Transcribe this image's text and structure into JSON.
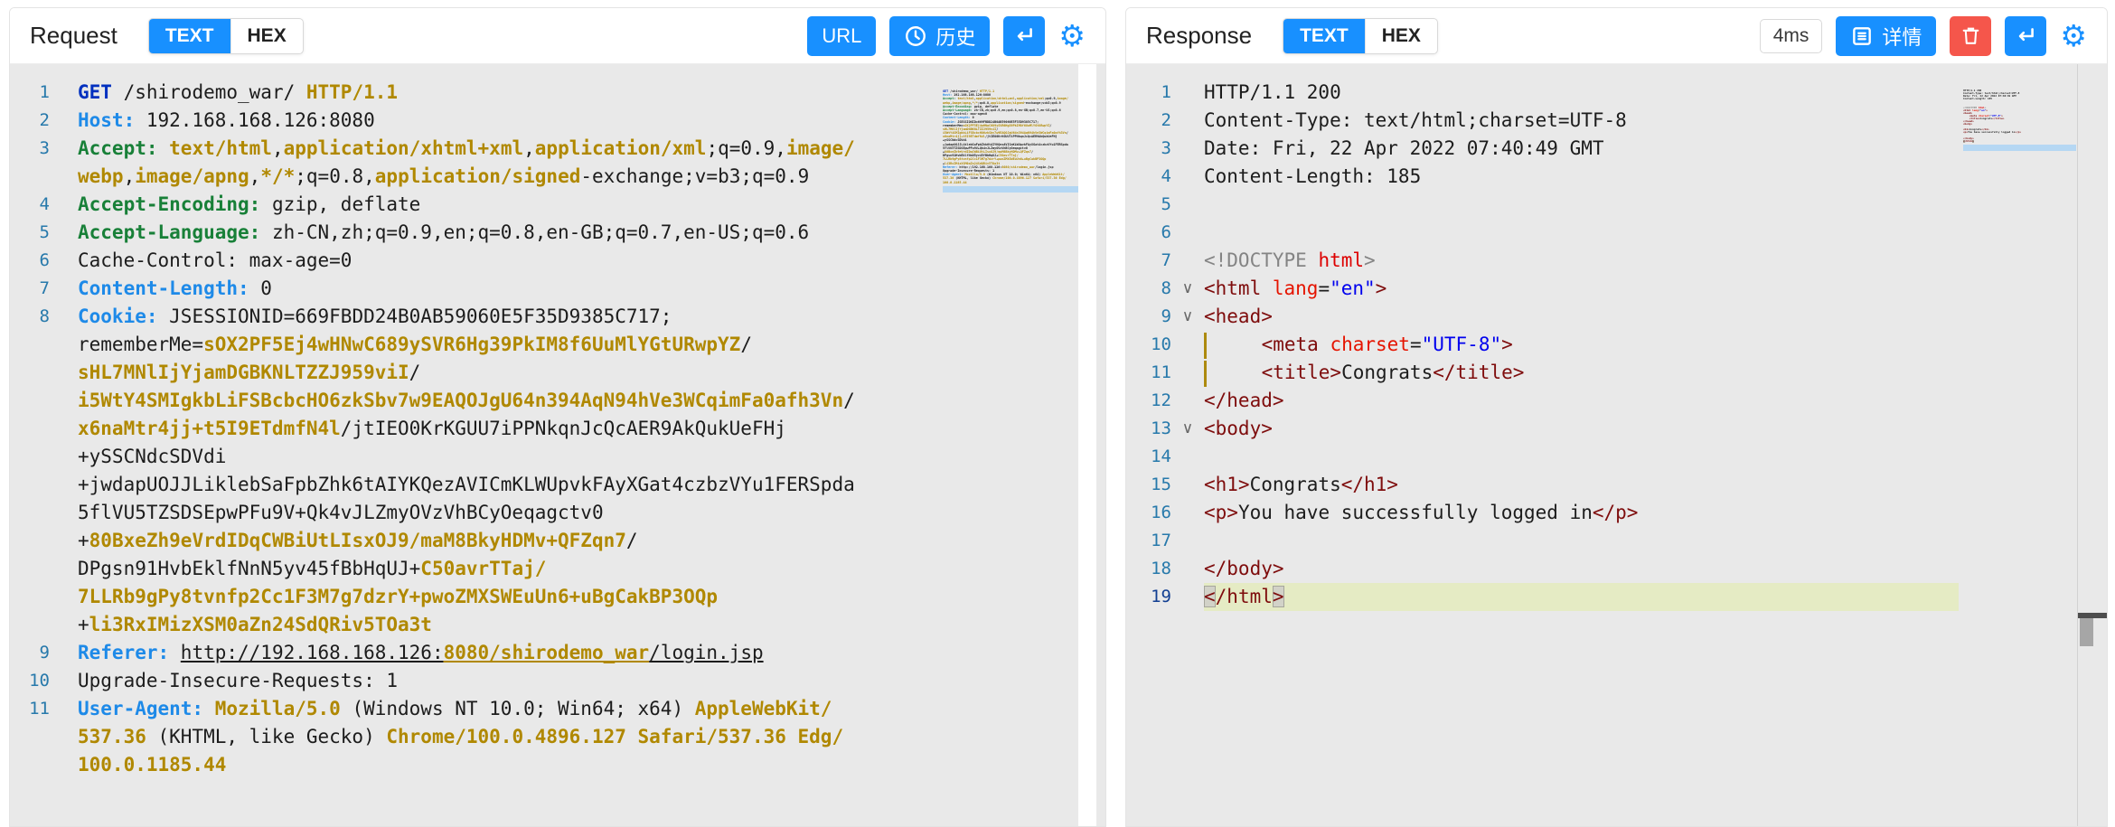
{
  "colors": {
    "accent": "#1890ff",
    "danger": "#f5564b",
    "editor_bg": "#e9e9e9",
    "line_highlight": "#e5ebc4",
    "gold": "#b08800"
  },
  "request": {
    "title": "Request",
    "tabs": [
      {
        "label": "TEXT",
        "active": true
      },
      {
        "label": "HEX",
        "active": false
      }
    ],
    "buttons": {
      "url": "URL",
      "history": "历史"
    },
    "icons": [
      "clock-icon",
      "enter-icon",
      "gear-icon"
    ],
    "lines": [
      {
        "n": "1",
        "s": [
          [
            "k",
            "GET"
          ],
          [
            "p",
            " /shirodemo_war/ "
          ],
          [
            "g",
            "HTTP/1.1"
          ]
        ]
      },
      {
        "n": "2",
        "s": [
          [
            "b",
            "Host: "
          ],
          [
            "p",
            "192.168.168.126:8080"
          ]
        ]
      },
      {
        "n": "3",
        "s": [
          [
            "gr",
            "Accept: "
          ],
          [
            "g",
            "text/html"
          ],
          [
            "p",
            ","
          ],
          [
            "g",
            "application/xhtml+xml"
          ],
          [
            "p",
            ","
          ],
          [
            "g",
            "application/xml"
          ],
          [
            "p",
            ";q=0.9,"
          ],
          [
            "g",
            "image/"
          ]
        ]
      },
      {
        "n": "",
        "s": [
          [
            "g",
            "webp"
          ],
          [
            "p",
            ","
          ],
          [
            "g",
            "image/apng"
          ],
          [
            "p",
            ","
          ],
          [
            "g",
            "*/*"
          ],
          [
            "p",
            ";q=0.8,"
          ],
          [
            "g",
            "application/signed"
          ],
          [
            "p",
            "-exchange;v=b3;q=0.9"
          ]
        ]
      },
      {
        "n": "4",
        "s": [
          [
            "gr",
            "Accept-Encoding: "
          ],
          [
            "p",
            "gzip, deflate"
          ]
        ]
      },
      {
        "n": "5",
        "s": [
          [
            "gr",
            "Accept-Language: "
          ],
          [
            "p",
            "zh-CN,zh;q=0.9,en;q=0.8,en-GB;q=0.7,en-US;q=0.6"
          ]
        ]
      },
      {
        "n": "6",
        "s": [
          [
            "p",
            "Cache-Control: max-age=0"
          ]
        ]
      },
      {
        "n": "7",
        "s": [
          [
            "b",
            "Content-Length: "
          ],
          [
            "p",
            "0"
          ]
        ]
      },
      {
        "n": "8",
        "s": [
          [
            "b",
            "Cookie: "
          ],
          [
            "p",
            "JSESSIONID=669FBDD24B0AB59060E5F35D9385C717;"
          ]
        ]
      },
      {
        "n": "",
        "s": [
          [
            "p",
            "rememberMe="
          ],
          [
            "g",
            "sOX2PF5Ej4wHNwC689ySVR6Hg39PkIM8f6UuMlYGtURwpYZ"
          ],
          [
            "p",
            "/"
          ]
        ]
      },
      {
        "n": "",
        "s": [
          [
            "g",
            "sHL7MNlIjYjamDGBKNLTZZJ959viI"
          ],
          [
            "p",
            "/"
          ]
        ]
      },
      {
        "n": "",
        "s": [
          [
            "g",
            "i5WtY4SMIgkbLiFSBcbcHO6zkSbv7w9EAQOJgU64n394AqN94hVe3WCqimFa0afh3Vn"
          ],
          [
            "p",
            "/"
          ]
        ]
      },
      {
        "n": "",
        "s": [
          [
            "g",
            "x6naMtr4jj+t5I9ETdmfN4l"
          ],
          [
            "p",
            "/jtIEO0KrKGUU7iPPNkqnJcQcAER9AkQukUeFHj"
          ]
        ]
      },
      {
        "n": "",
        "s": [
          [
            "p",
            "+ySSCNdcSDVdi"
          ]
        ]
      },
      {
        "n": "",
        "s": [
          [
            "p",
            "+jwdapUOJJLiklebSaFpbZhk6tAIYKQezAVICmKLWUpvkFAyXGat4czbzVYu1FERSpda"
          ]
        ]
      },
      {
        "n": "",
        "s": [
          [
            "p",
            "5flVU5TZSDSEpwPFu9V+Qk4vJLZmyOVzVhBCyOeqagctv0"
          ]
        ]
      },
      {
        "n": "",
        "s": [
          [
            "p",
            "+"
          ],
          [
            "g",
            "80BxeZh9eVrdIDqCWBiUtLIsxOJ9/maM8BkyHDMv+QFZqn7"
          ],
          [
            "p",
            "/"
          ]
        ]
      },
      {
        "n": "",
        "s": [
          [
            "p",
            "DPgsn91HvbEklfNnN5yv45fBbHqUJ+"
          ],
          [
            "g",
            "C50avrTTaj/"
          ]
        ]
      },
      {
        "n": "",
        "s": [
          [
            "g",
            "7LLRb9gPy8tvnfp2Cc1F3M7g7dzrY+pwoZMXSWEuUn6+uBgCakBP3OQp"
          ]
        ]
      },
      {
        "n": "",
        "s": [
          [
            "p",
            "+"
          ],
          [
            "g",
            "li3RxIMizXSM0aZn24SdQRiv5TOa3t"
          ]
        ]
      },
      {
        "n": "9",
        "s": [
          [
            "b",
            "Referer: "
          ],
          [
            "u",
            "http://192.168.168.126:"
          ],
          [
            "ug",
            "8080/shirodemo_war"
          ],
          [
            "u",
            "/login.jsp"
          ]
        ]
      },
      {
        "n": "10",
        "s": [
          [
            "p",
            "Upgrade-Insecure-Requests: 1"
          ]
        ]
      },
      {
        "n": "11",
        "s": [
          [
            "b",
            "User-Agent: "
          ],
          [
            "g",
            "Mozilla/5.0"
          ],
          [
            "p",
            " (Windows NT 10.0; Win64; x64) "
          ],
          [
            "g",
            "AppleWebKit/"
          ]
        ]
      },
      {
        "n": "",
        "s": [
          [
            "g",
            "537.36"
          ],
          [
            "p",
            " (KHTML, like Gecko) "
          ],
          [
            "g",
            "Chrome/100.0.4896.127 Safari/537.36 Edg/"
          ]
        ]
      },
      {
        "n": "",
        "s": [
          [
            "g",
            "100.0.1185.44"
          ]
        ]
      }
    ]
  },
  "response": {
    "title": "Response",
    "tabs": [
      {
        "label": "TEXT",
        "active": true
      },
      {
        "label": "HEX",
        "active": false
      }
    ],
    "badge": "4ms",
    "buttons": {
      "detail": "详情"
    },
    "icons": [
      "detail-icon",
      "trash-icon",
      "enter-icon",
      "gear-icon"
    ],
    "lines": [
      {
        "n": "1",
        "s": [
          [
            "p",
            "HTTP/1.1 200"
          ]
        ]
      },
      {
        "n": "2",
        "s": [
          [
            "p",
            "Content-Type: text/html;charset=UTF-8"
          ]
        ]
      },
      {
        "n": "3",
        "s": [
          [
            "p",
            "Date: Fri, 22 Apr 2022 07:40:49 GMT"
          ]
        ]
      },
      {
        "n": "4",
        "s": [
          [
            "p",
            "Content-Length: 185"
          ]
        ]
      },
      {
        "n": "5",
        "s": []
      },
      {
        "n": "6",
        "s": []
      },
      {
        "n": "7",
        "s": [
          [
            "pc",
            "<!DOCTYPE "
          ],
          [
            "rd",
            "html"
          ],
          [
            "pc",
            ">"
          ]
        ]
      },
      {
        "n": "8",
        "fold": true,
        "s": [
          [
            "tg",
            "<html "
          ],
          [
            "at",
            "lang"
          ],
          [
            "p",
            "="
          ],
          [
            "av",
            "\"en\""
          ],
          [
            "tg",
            ">"
          ]
        ]
      },
      {
        "n": "9",
        "fold": true,
        "s": [
          [
            "tg",
            "<head>"
          ]
        ]
      },
      {
        "n": "10",
        "guide": true,
        "s": [
          [
            "tg",
            "    <meta "
          ],
          [
            "at",
            "charset"
          ],
          [
            "p",
            "="
          ],
          [
            "av",
            "\"UTF-8\""
          ],
          [
            "tg",
            ">"
          ]
        ]
      },
      {
        "n": "11",
        "guide": true,
        "s": [
          [
            "tg",
            "    <title>"
          ],
          [
            "p",
            "Congrats"
          ],
          [
            "tg",
            "</title>"
          ]
        ]
      },
      {
        "n": "12",
        "s": [
          [
            "tg",
            "</head>"
          ]
        ]
      },
      {
        "n": "13",
        "fold": true,
        "s": [
          [
            "tg",
            "<body>"
          ]
        ]
      },
      {
        "n": "14",
        "s": []
      },
      {
        "n": "15",
        "s": [
          [
            "tg",
            "<h1>"
          ],
          [
            "p",
            "Congrats"
          ],
          [
            "tg",
            "</h1>"
          ]
        ]
      },
      {
        "n": "16",
        "s": [
          [
            "tg",
            "<p>"
          ],
          [
            "p",
            "You have successfully logged in"
          ],
          [
            "tg",
            "</p>"
          ]
        ]
      },
      {
        "n": "17",
        "s": []
      },
      {
        "n": "18",
        "s": [
          [
            "tg",
            "</body>"
          ]
        ]
      },
      {
        "n": "19",
        "hl": true,
        "active": true,
        "s": [
          [
            "bm",
            "<"
          ],
          [
            "tg",
            "/html"
          ],
          [
            "bm",
            ">"
          ]
        ]
      }
    ]
  }
}
